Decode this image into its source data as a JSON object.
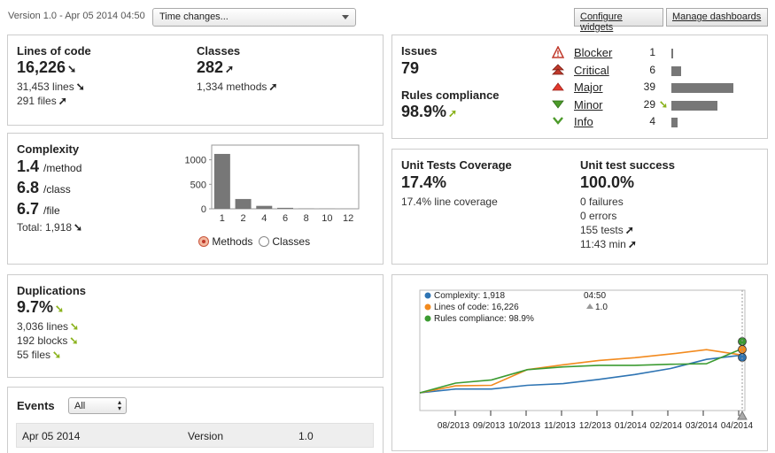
{
  "header": {
    "version": "Version 1.0 - Apr 05 2014 04:50",
    "time_changes": "Time changes...",
    "configure_widgets": "Configure widgets",
    "manage_dashboards": "Manage dashboards"
  },
  "size": {
    "loc_label": "Lines of code",
    "loc_value": "16,226",
    "lines": "31,453 lines",
    "files": "291 files",
    "classes_label": "Classes",
    "classes_value": "282",
    "methods": "1,334 methods"
  },
  "complexity": {
    "label": "Complexity",
    "per_method": "1.4",
    "per_method_unit": "/method",
    "per_class": "6.8",
    "per_class_unit": "/class",
    "per_file": "6.7",
    "per_file_unit": "/file",
    "total": "Total: 1,918",
    "radio_methods": "Methods",
    "radio_classes": "Classes"
  },
  "chart_data": [
    {
      "type": "bar",
      "categories": [
        "1",
        "2",
        "4",
        "6",
        "8",
        "10",
        "12"
      ],
      "values": [
        1120,
        200,
        60,
        20,
        5,
        3,
        2
      ],
      "title": "",
      "xlabel": "",
      "ylabel": "",
      "yticks": [
        "0",
        "500",
        "1000"
      ],
      "ylim": [
        0,
        1300
      ]
    },
    {
      "type": "line",
      "x": [
        "08/2013",
        "09/2013",
        "10/2013",
        "11/2013",
        "12/2013",
        "01/2014",
        "02/2014",
        "03/2014",
        "04/2014"
      ],
      "series": [
        {
          "name": "Complexity: 1,918",
          "color": "#2e74b3",
          "values": [
            0.0,
            0.07,
            0.07,
            0.14,
            0.17,
            0.25,
            0.34,
            0.45,
            0.62,
            0.7
          ]
        },
        {
          "name": "Lines of code: 16,226",
          "color": "#f28a1e",
          "values": [
            0.0,
            0.13,
            0.14,
            0.43,
            0.52,
            0.6,
            0.65,
            0.72,
            0.8,
            0.7
          ]
        },
        {
          "name": "Rules compliance: 98.9%",
          "color": "#3c9b32",
          "values": [
            0.0,
            0.18,
            0.24,
            0.43,
            0.48,
            0.51,
            0.51,
            0.53,
            0.54,
            0.82
          ]
        }
      ],
      "legend_time": "04:50",
      "legend_version": "1.0",
      "grid": false,
      "legend_placement": "top-left"
    }
  ],
  "duplications": {
    "label": "Duplications",
    "value": "9.7%",
    "lines": "3,036 lines",
    "blocks": "192 blocks",
    "files": "55 files"
  },
  "events": {
    "label": "Events",
    "filter": "All",
    "rows": [
      {
        "date": "Apr 05 2014",
        "category": "Version",
        "name": "1.0"
      }
    ]
  },
  "issues": {
    "label": "Issues",
    "value": "79",
    "rules_label": "Rules compliance",
    "rules_value": "98.9%",
    "severities": [
      {
        "name": "Blocker",
        "count": "1",
        "fraction": 0.03,
        "icon": "blocker-icon",
        "color": "#c0392b"
      },
      {
        "name": "Critical",
        "count": "6",
        "fraction": 0.15,
        "icon": "critical-icon",
        "color": "#c0392b"
      },
      {
        "name": "Major",
        "count": "39",
        "fraction": 1.0,
        "icon": "major-icon",
        "color": "#d9332a"
      },
      {
        "name": "Minor",
        "count": "29",
        "fraction": 0.74,
        "icon": "minor-icon",
        "color": "#4c9a2a"
      },
      {
        "name": "Info",
        "count": "4",
        "fraction": 0.1,
        "icon": "info-icon",
        "color": "#4c9a2a"
      }
    ]
  },
  "coverage": {
    "label": "Unit Tests Coverage",
    "value": "17.4%",
    "line_coverage": "17.4% line coverage",
    "success_label": "Unit test success",
    "success_value": "100.0%",
    "failures": "0 failures",
    "errors": "0 errors",
    "tests": "155 tests",
    "time": "11:43 min"
  }
}
